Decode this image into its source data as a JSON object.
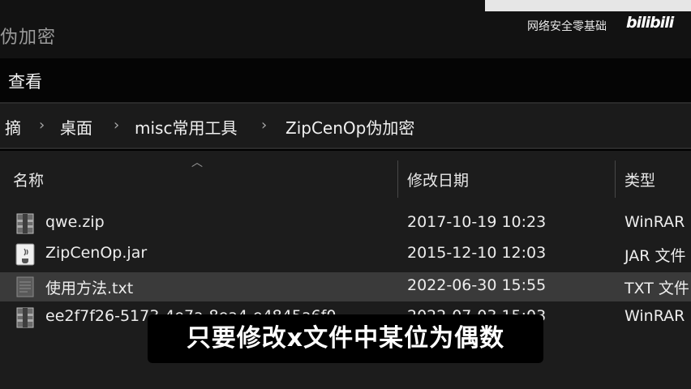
{
  "window": {
    "title": "伪加密"
  },
  "watermark": {
    "text": "网络安全零基础",
    "logo": "bilibili"
  },
  "ribbon": {
    "view_label": "查看"
  },
  "breadcrumb": {
    "items": [
      "摘",
      "桌面",
      "misc常用工具",
      "ZipCenOp伪加密"
    ],
    "separator": "›"
  },
  "columns": {
    "name": "名称",
    "modified": "修改日期",
    "type": "类型"
  },
  "files": [
    {
      "name": "qwe.zip",
      "modified": "2017-10-19 10:23",
      "type": "WinRAR",
      "icon": "winrar-archive-icon"
    },
    {
      "name": "ZipCenOp.jar",
      "modified": "2015-12-10 12:03",
      "type": "JAR 文件",
      "icon": "java-jar-icon"
    },
    {
      "name": "使用方法.txt",
      "modified": "2022-06-30 15:55",
      "type": "TXT 文件",
      "icon": "text-file-icon",
      "selected": true
    },
    {
      "name": "ee2f7f26-5173-4e7a-8ea4-e4845a6f0...",
      "modified": "2022-07-03 15:03",
      "type": "WinRAR",
      "icon": "winrar-archive-icon"
    }
  ],
  "subtitle": {
    "text": "只要修改x文件中某位为偶数"
  },
  "colors": {
    "background": "#1c1c1c",
    "selected_row": "#3a3a3a",
    "text": "#ededed"
  }
}
